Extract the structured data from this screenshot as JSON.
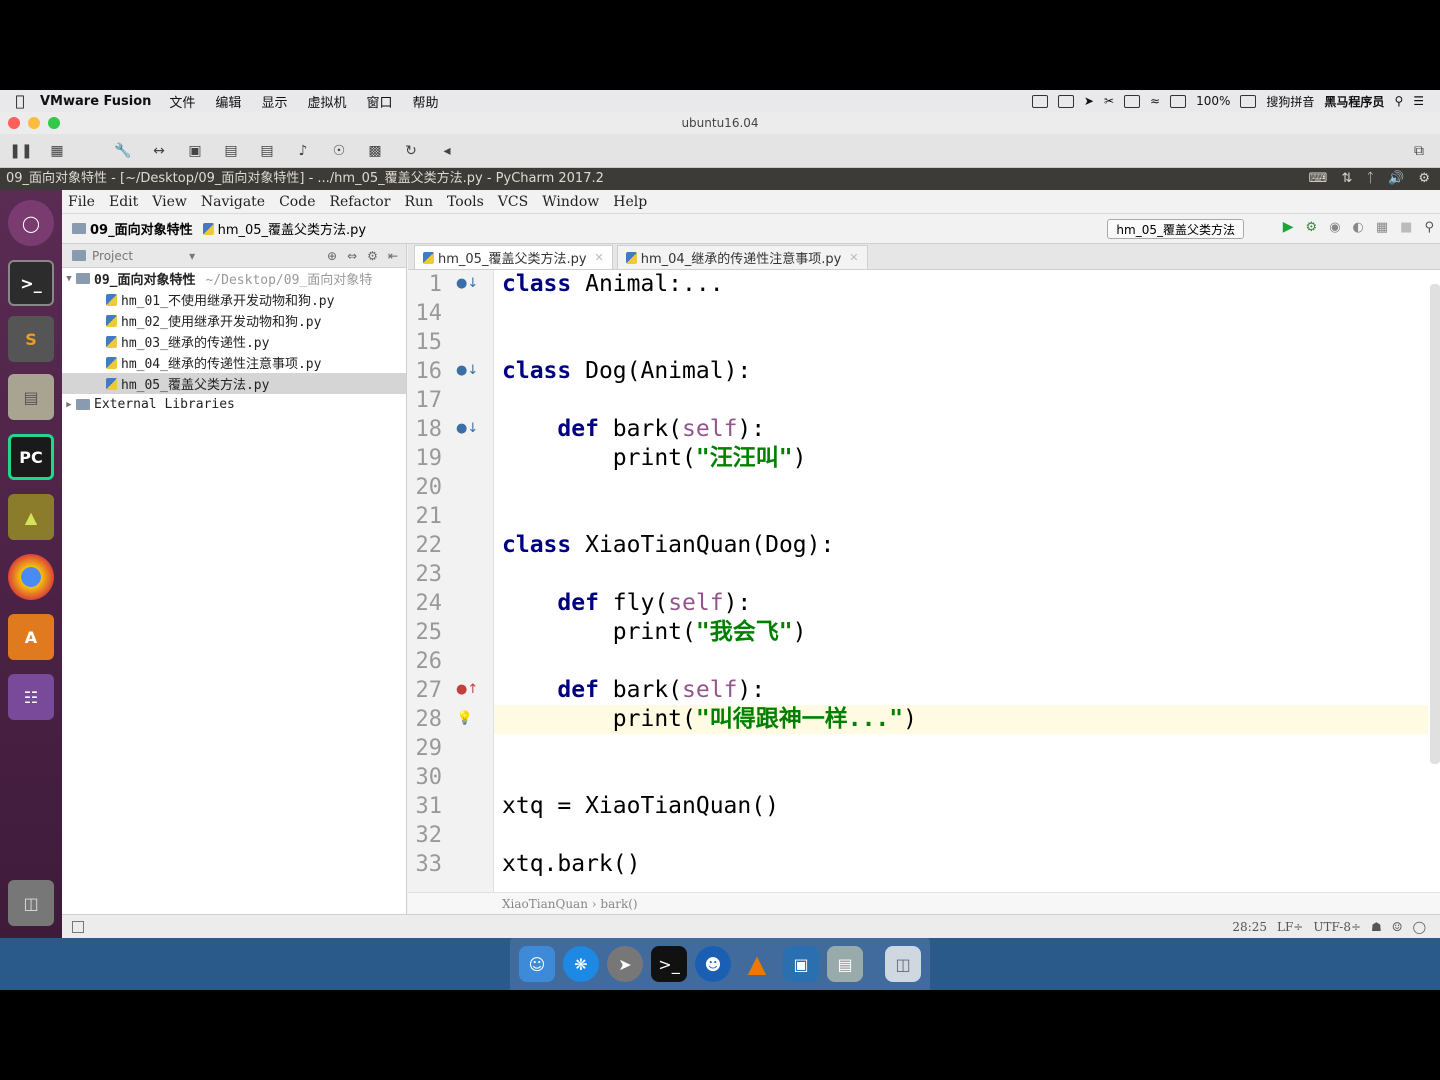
{
  "mac_menubar": {
    "app": "VMware Fusion",
    "menus": [
      "文件",
      "编辑",
      "显示",
      "虚拟机",
      "窗口",
      "帮助"
    ],
    "battery": "100%",
    "input_method": "搜狗拼音",
    "user": "黑马程序员"
  },
  "vm": {
    "title": "ubuntu16.04"
  },
  "ubuntu": {
    "window_title": "09_面向对象特性 - [~/Desktop/09_面向对象特性] - .../hm_05_覆盖父类方法.py - PyCharm 2017.2"
  },
  "launcher": {
    "items": [
      "ubuntu-icon",
      "terminal-icon",
      "sublime-icon",
      "files-icon",
      "pycharm-icon",
      "archive-icon",
      "chrome-icon",
      "software-center-icon",
      "workspace-icon",
      "trash-icon"
    ]
  },
  "pycharm": {
    "menu": [
      "File",
      "Edit",
      "View",
      "Navigate",
      "Code",
      "Refactor",
      "Run",
      "Tools",
      "VCS",
      "Window",
      "Help"
    ],
    "nav": {
      "project": "09_面向对象特性",
      "file": "hm_05_覆盖父类方法.py"
    },
    "run_config": "hm_05_覆盖父类方法",
    "project_panel": {
      "header": "Project",
      "root_name": "09_面向对象特性",
      "root_path": "~/Desktop/09_面向对象特",
      "files": [
        "hm_01_不使用继承开发动物和狗.py",
        "hm_02_使用继承开发动物和狗.py",
        "hm_03_继承的传递性.py",
        "hm_04_继承的传递性注意事项.py",
        "hm_05_覆盖父类方法.py"
      ],
      "external": "External Libraries"
    },
    "tabs": [
      "hm_05_覆盖父类方法.py",
      "hm_04_继承的传递性注意事项.py"
    ],
    "code_lines": [
      {
        "num": "1",
        "parts": [
          [
            "kw",
            "class"
          ],
          [
            "",
            " Animal:..."
          ]
        ]
      },
      {
        "num": "14",
        "parts": []
      },
      {
        "num": "15",
        "parts": []
      },
      {
        "num": "16",
        "parts": [
          [
            "kw",
            "class"
          ],
          [
            "",
            " Dog(Animal):"
          ]
        ]
      },
      {
        "num": "17",
        "parts": []
      },
      {
        "num": "18",
        "parts": [
          [
            "",
            "    "
          ],
          [
            "kw",
            "def"
          ],
          [
            "",
            " bark("
          ],
          [
            "self",
            "self"
          ],
          [
            "",
            "):"
          ]
        ]
      },
      {
        "num": "19",
        "parts": [
          [
            "",
            "        print("
          ],
          [
            "str",
            "\"汪汪叫\""
          ],
          [
            "",
            ")"
          ]
        ]
      },
      {
        "num": "20",
        "parts": []
      },
      {
        "num": "21",
        "parts": []
      },
      {
        "num": "22",
        "parts": [
          [
            "kw",
            "class"
          ],
          [
            "",
            " XiaoTianQuan(Dog):"
          ]
        ]
      },
      {
        "num": "23",
        "parts": []
      },
      {
        "num": "24",
        "parts": [
          [
            "",
            "    "
          ],
          [
            "kw",
            "def"
          ],
          [
            "",
            " fly("
          ],
          [
            "self",
            "self"
          ],
          [
            "",
            "):"
          ]
        ]
      },
      {
        "num": "25",
        "parts": [
          [
            "",
            "        print("
          ],
          [
            "str",
            "\"我会飞\""
          ],
          [
            "",
            ")"
          ]
        ]
      },
      {
        "num": "26",
        "parts": []
      },
      {
        "num": "27",
        "parts": [
          [
            "",
            "    "
          ],
          [
            "kw",
            "def"
          ],
          [
            "",
            " bark("
          ],
          [
            "self",
            "self"
          ],
          [
            "",
            "):"
          ]
        ]
      },
      {
        "num": "28",
        "parts": [
          [
            "",
            "        print("
          ],
          [
            "str",
            "\"叫得跟神一样...\""
          ],
          [
            "",
            ")"
          ]
        ]
      },
      {
        "num": "29",
        "parts": []
      },
      {
        "num": "30",
        "parts": []
      },
      {
        "num": "31",
        "parts": [
          [
            "",
            "xtq = XiaoTianQuan()"
          ]
        ]
      },
      {
        "num": "32",
        "parts": []
      },
      {
        "num": "33",
        "parts": [
          [
            "",
            "xtq.bark()"
          ]
        ]
      }
    ],
    "breadcrumb": [
      "XiaoTianQuan",
      "bark()"
    ],
    "status": {
      "position": "28:25",
      "line_sep": "LF÷",
      "encoding": "UTF-8÷"
    }
  },
  "dock": {
    "items": [
      "finder-icon",
      "safari-icon",
      "launchpad-icon",
      "terminal-icon",
      "qq-icon",
      "vlc-icon",
      "vmware-icon",
      "preview-icon",
      "trash-icon"
    ]
  },
  "colors": {
    "keyword": "#000080",
    "self": "#94558d",
    "string": "#008000",
    "launcher": "#5a2b53",
    "current_line": "#fffbe3"
  }
}
